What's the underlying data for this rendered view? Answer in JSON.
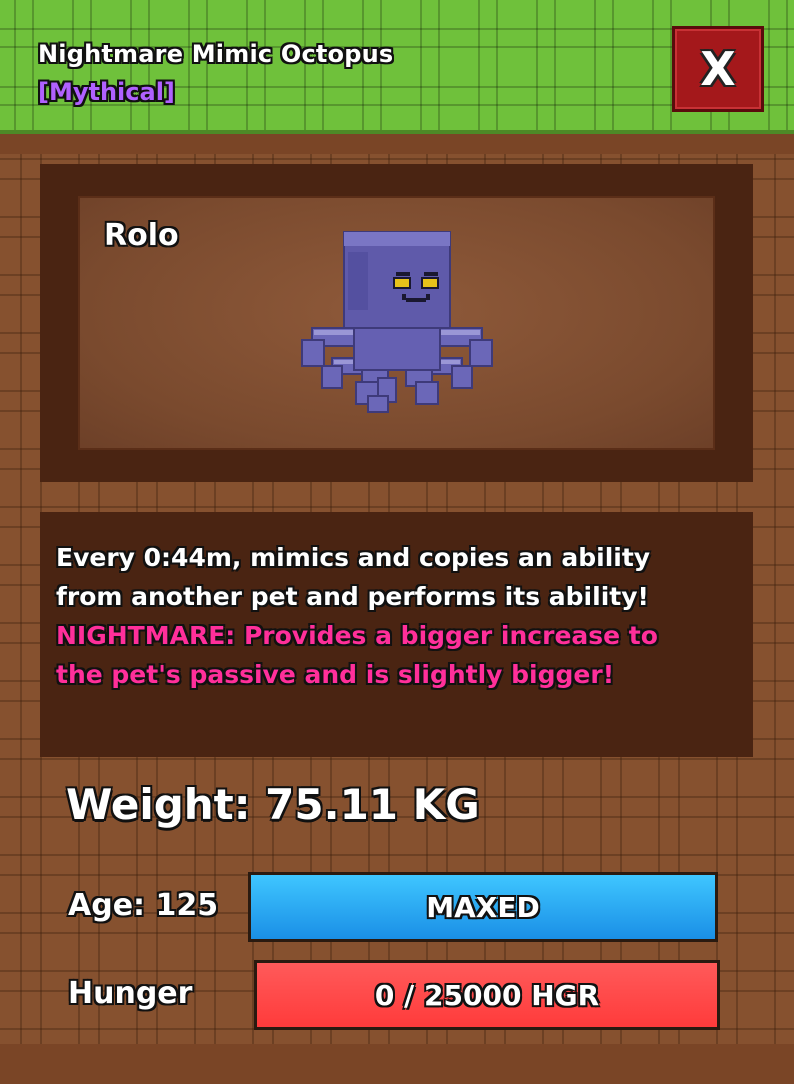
{
  "header": {
    "title": "Nightmare Mimic Octopus",
    "rarity": "[Mythical]",
    "rarity_color": "#b061ff",
    "close_label": "X",
    "close_icon": "close-icon"
  },
  "preview": {
    "pet_name": "Rolo",
    "pet_art": "octopus-pet-icon"
  },
  "description": {
    "line1": "Every 0:44m, mimics and copies an ability",
    "line2": "from another pet and performs its ability!",
    "line3": "NIGHTMARE: Provides a bigger increase to",
    "line4": "the pet's passive and is slightly bigger!",
    "nightmare_color": "#ff2f9a"
  },
  "stats": {
    "weight": "Weight: 75.11 KG",
    "age_label": "Age: 125",
    "age_status": "MAXED",
    "age_progress": 1.0,
    "hunger_label": "Hunger",
    "hunger_value": "0 / 25000 HGR",
    "hunger_progress": 1.0
  },
  "colors": {
    "header_green": "#6fc13b",
    "panel_brown": "#86512f",
    "age_bar": "#3fc6ff",
    "hunger_bar": "#ff3b3b",
    "close_red": "#a4181b"
  }
}
